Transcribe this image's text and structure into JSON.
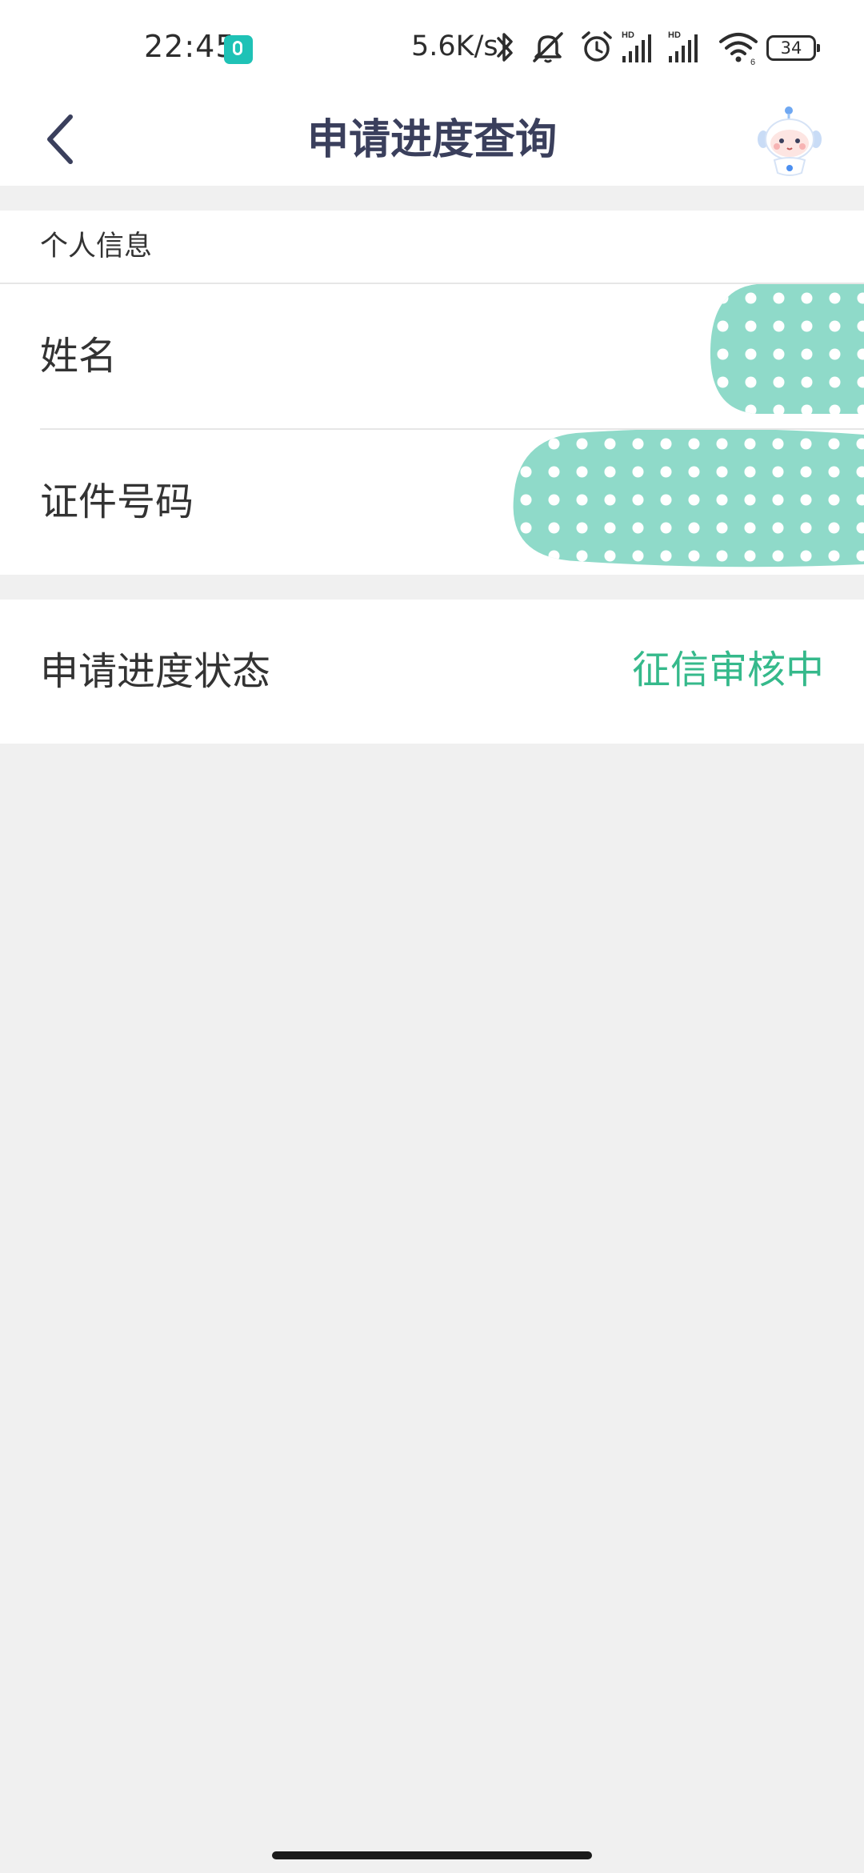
{
  "status_bar": {
    "time": "22:45",
    "network_speed": "5.6K/s",
    "battery_level": "34",
    "icons": [
      "app-notification-icon",
      "bluetooth-icon",
      "mute-icon",
      "alarm-icon",
      "hd-signal-icon",
      "hd-signal-icon",
      "wifi-icon",
      "battery-icon"
    ]
  },
  "header": {
    "title": "申请进度查询",
    "back_icon": "chevron-left-icon",
    "avatar_icon": "robot-mascot-icon",
    "title_color": "#3a3f5c"
  },
  "personal_info": {
    "section_title": "个人信息",
    "fields": [
      {
        "label": "姓名"
      },
      {
        "label": "证件号码"
      }
    ],
    "mask_color": "#8fdac9"
  },
  "application_status": {
    "label": "申请进度状态",
    "value": "征信审核中",
    "value_color": "#35b98b"
  }
}
